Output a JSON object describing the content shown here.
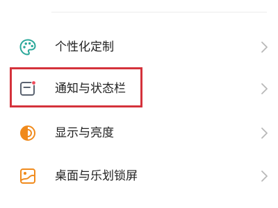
{
  "settings": {
    "items": [
      {
        "label": "个性化定制",
        "icon": "palette-icon",
        "icon_color": "#2aa89a"
      },
      {
        "label": "通知与状态栏",
        "icon": "notification-bar-icon",
        "icon_color": "#5a6270",
        "badge_color": "#ef4a5a"
      },
      {
        "label": "显示与亮度",
        "icon": "brightness-icon",
        "icon_color": "#f08a1c"
      },
      {
        "label": "桌面与乐划锁屏",
        "icon": "wallpaper-icon",
        "icon_color": "#f08a1c"
      }
    ],
    "chevron_icon": "chevron-right-icon",
    "chevron_color": "#b8b8b8",
    "highlight_color": "#d4323b",
    "highlighted_item": "通知与状态栏"
  }
}
